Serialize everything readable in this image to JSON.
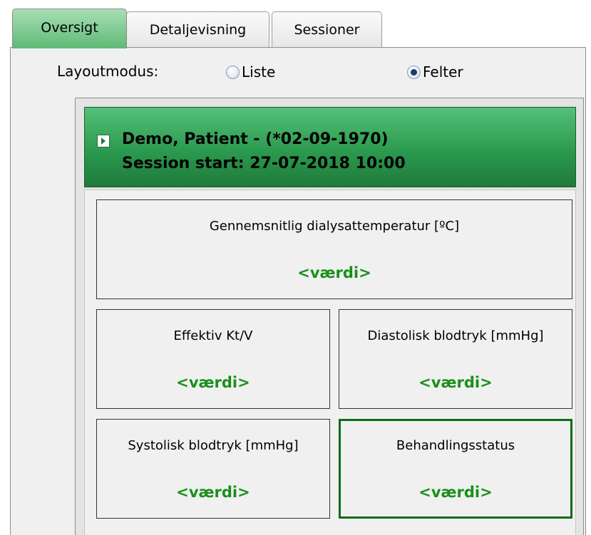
{
  "tabs": [
    {
      "label": "Oversigt",
      "active": true
    },
    {
      "label": "Detaljevisning",
      "active": false
    },
    {
      "label": "Sessioner",
      "active": false
    }
  ],
  "layout_mode": {
    "label": "Layoutmodus:",
    "options": [
      {
        "label": "Liste",
        "selected": false
      },
      {
        "label": "Felter",
        "selected": true
      }
    ]
  },
  "patient": {
    "name_line": "Demo, Patient - (*02-09-1970)",
    "session_line": "Session start: 27-07-2018 10:00"
  },
  "fields": [
    {
      "label": "Gennemsnitlig dialysattemperatur [ºC]",
      "value": "<værdi>"
    },
    {
      "label": "Effektiv Kt/V",
      "value": "<værdi>"
    },
    {
      "label": "Diastolisk blodtryk [mmHg]",
      "value": "<værdi>"
    },
    {
      "label": "Systolisk blodtryk [mmHg]",
      "value": "<værdi>"
    },
    {
      "label": "Behandlingsstatus",
      "value": "<værdi>",
      "selected": true
    }
  ],
  "colors": {
    "active_tab": "#5fb976",
    "header_green": "#2b9a4e",
    "value_green": "#1a8f1a",
    "selected_border": "#0a6b19"
  },
  "icons": {
    "expand": "expand-arrow-icon"
  }
}
